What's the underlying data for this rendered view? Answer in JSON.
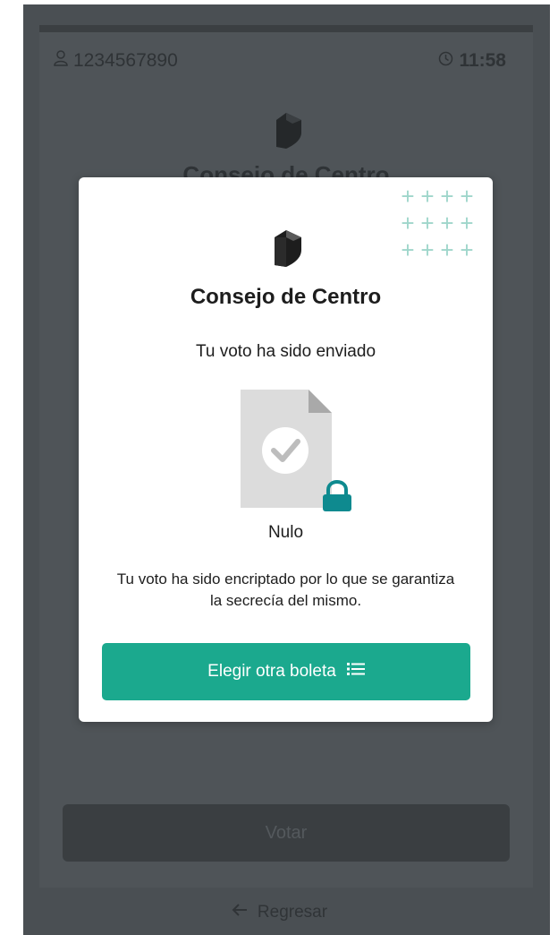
{
  "background": {
    "user_id": "1234567890",
    "time": "11:58",
    "title": "Consejo de Centro",
    "vote_button": "Votar",
    "back_link": "Regresar"
  },
  "modal": {
    "title": "Consejo de Centro",
    "status": "Tu voto ha sido enviado",
    "ballot_choice": "Nulo",
    "notice": "Tu voto ha sido encriptado por lo que se garantiza la secrecía del mismo.",
    "choose_button": "Elegir otra boleta",
    "decoration": "+"
  },
  "colors": {
    "accent": "#1ba98e",
    "overlay": "#4a4f53",
    "lock": "#0e8a8f"
  },
  "icons": {
    "user": "user-icon",
    "clock": "clock-icon",
    "logo": "logo-icon",
    "document": "document-check-icon",
    "lock": "lock-icon",
    "list": "list-icon",
    "back": "arrow-left-icon"
  }
}
